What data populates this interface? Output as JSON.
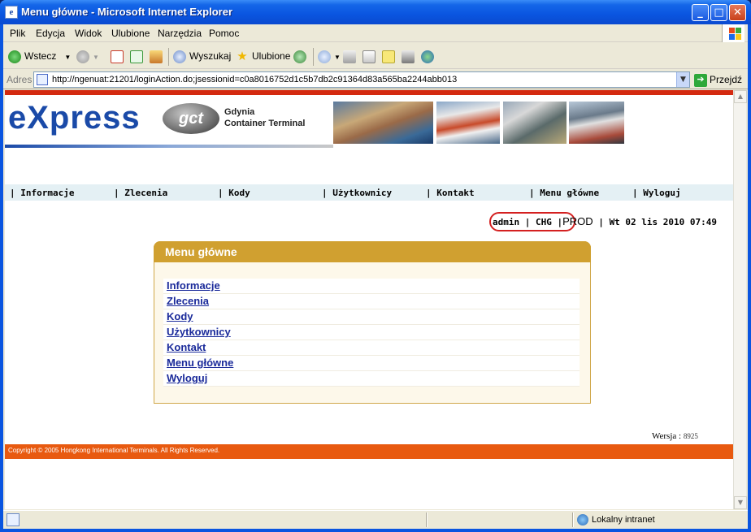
{
  "window": {
    "title": "Menu główne - Microsoft Internet Explorer",
    "min_label": "_",
    "max_label": "□",
    "close_label": "✕"
  },
  "menubar": [
    "Plik",
    "Edycja",
    "Widok",
    "Ulubione",
    "Narzędzia",
    "Pomoc"
  ],
  "toolbar": {
    "back": "Wstecz",
    "search": "Wyszukaj",
    "favorites": "Ulubione"
  },
  "address": {
    "label": "Adres",
    "url": "http://ngenuat:21201/loginAction.do;jsessionid=c0a8016752d1c5b7db2c91364d83a565ba2244abb013",
    "go": "Przejdź"
  },
  "banner": {
    "logo": "eXpress",
    "badge": "gct",
    "company_line1": "Gdynia",
    "company_line2": "Container Terminal"
  },
  "nav": {
    "items": [
      "| Informacje",
      "| Zlecenia",
      "| Kody",
      "| Użytkownicy",
      "| Kontakt",
      "| Menu główne",
      "| Wyloguj"
    ]
  },
  "session": {
    "user": "admin",
    "company": "CHG",
    "env": "PROD",
    "datetime": "Wt 02 lis 2010 07:49"
  },
  "panel": {
    "title": "Menu główne",
    "links": [
      "Informacje",
      "Zlecenia",
      "Kody",
      "Użytkownicy",
      "Kontakt",
      "Menu główne",
      "Wyloguj"
    ]
  },
  "version": {
    "label": "Wersja",
    "separator": ":",
    "number": "8925"
  },
  "footer": {
    "copyright": "Copyright © 2005 Hongkong International Terminals. All Rights Reserved."
  },
  "statusbar": {
    "zone": "Lokalny intranet"
  },
  "colors": {
    "accent_red": "#d42a10",
    "footer_orange": "#e85a10",
    "panel_gold": "#d0a030",
    "link_blue": "#1a2a9a",
    "logo_blue": "#1a4aa8",
    "nav_bg": "#e4f0f4"
  },
  "icons": {
    "back": "back-arrow-icon",
    "forward": "forward-arrow-icon",
    "stop": "stop-icon",
    "refresh": "refresh-icon",
    "home": "home-icon",
    "search": "search-icon",
    "favorites": "favorites-star-icon",
    "history": "history-icon",
    "mail": "mail-icon",
    "print": "print-icon",
    "edit": "edit-icon",
    "discuss": "discuss-icon",
    "research": "research-icon",
    "messenger": "messenger-icon"
  }
}
